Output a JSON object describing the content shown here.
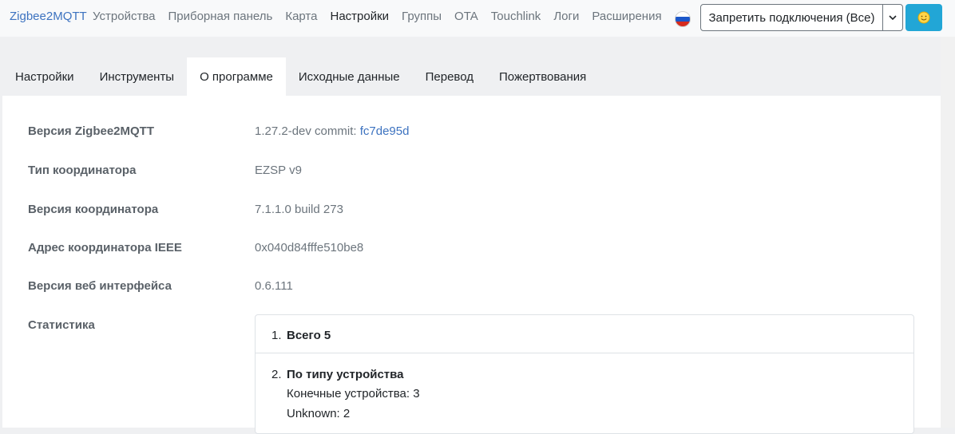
{
  "navbar": {
    "brand": "Zigbee2MQTT",
    "items": [
      "Устройства",
      "Приборная панель",
      "Карта",
      "Настройки",
      "Группы",
      "OTA",
      "Touchlink",
      "Логи",
      "Расширения"
    ],
    "active_index": 3,
    "language_flag": "russia-flag-icon",
    "permit_join_label": "Запретить подключения (Все)",
    "theme_icon": "sun-face-icon"
  },
  "tabs": {
    "items": [
      "Настройки",
      "Инструменты",
      "О программе",
      "Исходные данные",
      "Перевод",
      "Пожертвования"
    ],
    "active_index": 2
  },
  "about": {
    "z2m_version_label": "Версия Zigbee2MQTT",
    "z2m_version_value": "1.27.2-dev commit: ",
    "z2m_commit": "fc7de95d",
    "coordinator_type_label": "Тип координатора",
    "coordinator_type_value": "EZSP v9",
    "coordinator_version_label": "Версия координатора",
    "coordinator_version_value": "7.1.1.0 build 273",
    "coordinator_ieee_label": "Адрес координатора IEEE",
    "coordinator_ieee_value": "0x040d84fffe510be8",
    "frontend_version_label": "Версия веб интерфейса",
    "frontend_version_value": "0.6.111",
    "stats_label": "Статистика",
    "stats": {
      "total_num": "1.",
      "total_title": "Всего 5",
      "by_type_num": "2.",
      "by_type_title": "По типу устройства",
      "by_type_lines": [
        "Конечные устройства: 3",
        "Unknown: 2"
      ]
    }
  },
  "colors": {
    "accent": "#3d73c0",
    "theme_button": "#22a6d6"
  }
}
